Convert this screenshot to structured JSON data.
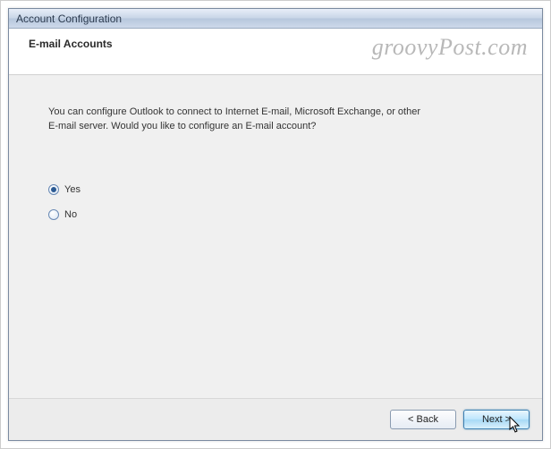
{
  "window": {
    "title": "Account Configuration"
  },
  "header": {
    "title": "E-mail Accounts"
  },
  "watermark": "groovyPost.com",
  "content": {
    "prompt": "You can configure Outlook to connect to Internet E-mail, Microsoft Exchange, or other E-mail server. Would you like to configure an E-mail account?",
    "options": {
      "yes": {
        "label": "Yes",
        "selected": true
      },
      "no": {
        "label": "No",
        "selected": false
      }
    }
  },
  "footer": {
    "back": "< Back",
    "next": "Next >"
  }
}
